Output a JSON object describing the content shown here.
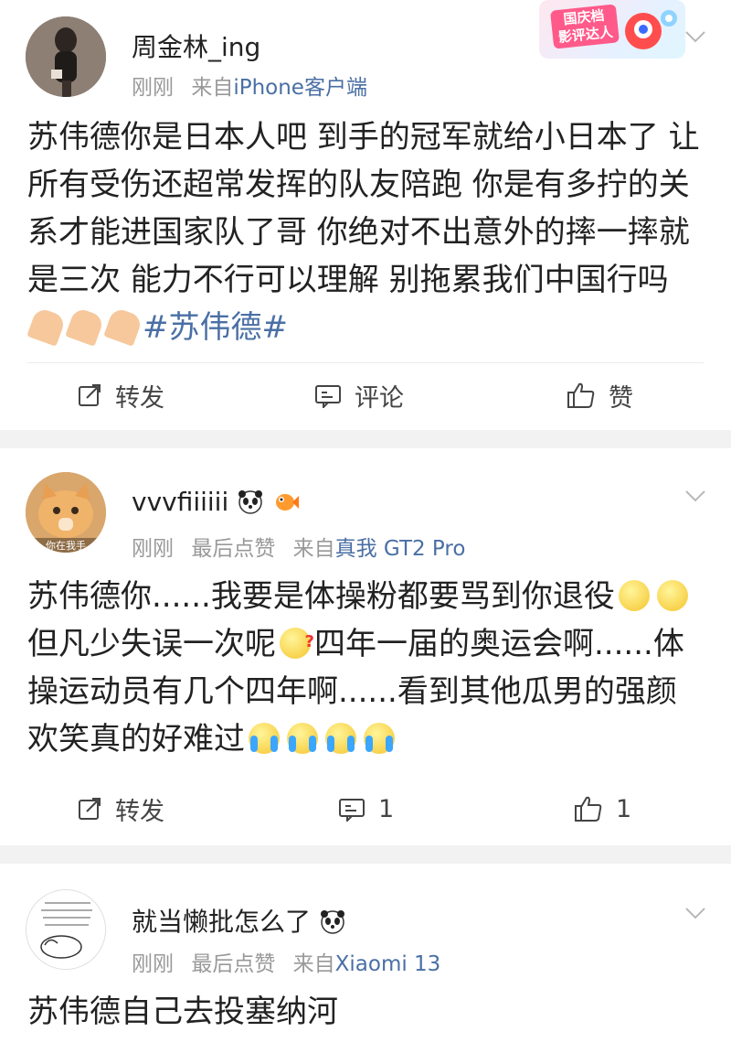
{
  "posts": [
    {
      "username": "周金林_ing",
      "time": "刚刚",
      "source_prefix": "来自",
      "source": "iPhone客户端",
      "badge": "国庆档\n影评达人",
      "text_main": "苏伟德你是日本人吧 到手的冠军就给小日本了 让所有受伤还超常发挥的队友陪跑 你是有多拧的关系才能进国家队了哥 你绝对不出意外的摔一摔就是三次 能力不行可以理解 别拖累我们中国行吗",
      "hashtag": "#苏伟德#",
      "actions": {
        "repost": "转发",
        "comment": "评论",
        "like": "赞"
      }
    },
    {
      "username": "vvvfiiiiii",
      "time": "刚刚",
      "liked": "最后点赞",
      "source_prefix": "来自",
      "source": "真我 GT2 Pro",
      "avatar_caption": "你在我手",
      "text_1": "苏伟德你......我要是体操粉都要骂到你退役",
      "text_2": "但凡少失误一次呢",
      "text_3": "四年一届的奥运会啊......体操运动员有几个四年啊......看到其他瓜男的强颜欢笑真的好难过",
      "actions": {
        "repost": "转发",
        "comment": "1",
        "like": "1"
      }
    },
    {
      "username": "就当懒批怎么了",
      "time": "刚刚",
      "liked": "最后点赞",
      "source_prefix": "来自",
      "source": "Xiaomi 13",
      "text": "苏伟德自己去投塞纳河"
    }
  ]
}
